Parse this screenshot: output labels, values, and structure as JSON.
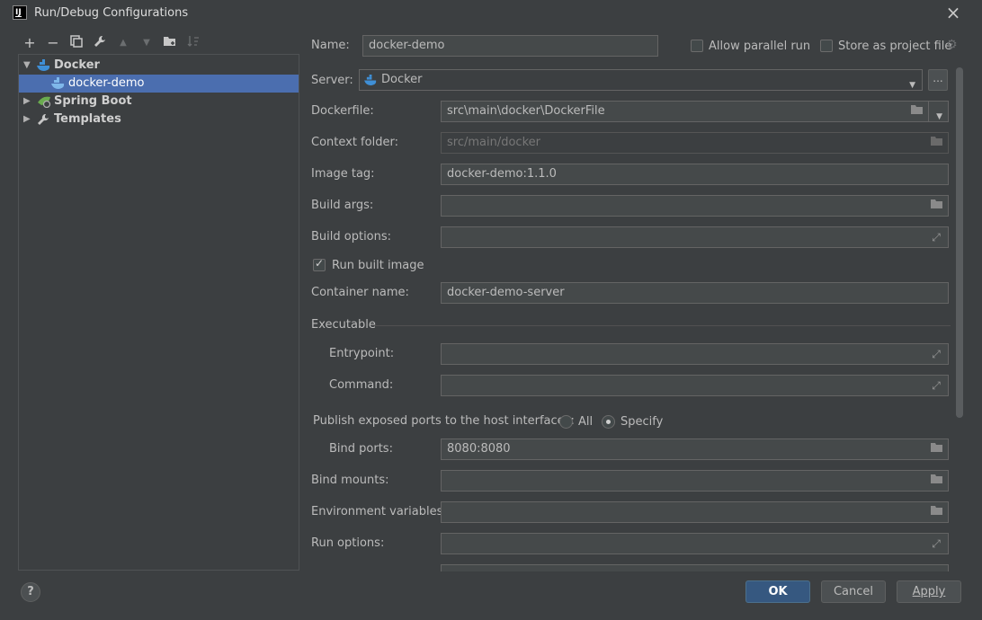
{
  "window": {
    "title": "Run/Debug Configurations",
    "logo_text": "IJ"
  },
  "toolbar": [
    {
      "name": "add-icon",
      "glyph": "+"
    },
    {
      "name": "remove-icon",
      "glyph": "−"
    },
    {
      "name": "copy-icon",
      "glyph": "⧉"
    },
    {
      "name": "wrench-icon",
      "glyph": "🔧"
    },
    {
      "name": "move-up-icon",
      "glyph": "▲"
    },
    {
      "name": "move-down-icon",
      "glyph": "▼"
    },
    {
      "name": "new-folder-icon",
      "glyph": "📁"
    },
    {
      "name": "sort-icon",
      "glyph": "↓"
    }
  ],
  "tree": {
    "items": [
      {
        "label": "Docker"
      },
      {
        "label": "docker-demo"
      },
      {
        "label": "Spring Boot"
      },
      {
        "label": "Templates"
      }
    ]
  },
  "header": {
    "name_label": "Name:",
    "name_value": "docker-demo",
    "parallel_label": "Allow parallel run",
    "store_label": "Store as project file"
  },
  "form": {
    "server_label": "Server:",
    "server_value": "Docker",
    "server_more": "...",
    "dockerfile_label": "Dockerfile:",
    "dockerfile_value": "src\\main\\docker\\DockerFile",
    "context_label": "Context folder:",
    "context_value": "src/main/docker",
    "image_tag_label": "Image tag:",
    "image_tag_value": "docker-demo:1.1.0",
    "build_args_label": "Build args:",
    "build_args_value": "",
    "build_options_label": "Build options:",
    "build_options_value": "",
    "run_built_label": "Run built image",
    "run_built_checked": true,
    "container_label": "Container name:",
    "container_value": "docker-demo-server",
    "executable_label": "Executable",
    "entrypoint_label": "Entrypoint:",
    "entrypoint_value": "",
    "command_label": "Command:",
    "command_value": "",
    "publish_label": "Publish exposed ports to the host interfaces:",
    "radio_all": "All",
    "radio_specify": "Specify",
    "bind_ports_label": "Bind ports:",
    "bind_ports_value": "8080:8080",
    "bind_mounts_label": "Bind mounts:",
    "bind_mounts_value": "",
    "env_label": "Environment variables:",
    "env_value": "",
    "run_options_label": "Run options:",
    "run_options_value": ""
  },
  "buttons": {
    "help": "?",
    "ok": "OK",
    "cancel": "Cancel",
    "apply": "Apply"
  },
  "colors": {
    "background": "#3c3f41",
    "selection": "#4b6eaf",
    "primary_button": "#365880",
    "docker_blue": "#3f8fd6",
    "spring_green": "#6aab4f"
  }
}
